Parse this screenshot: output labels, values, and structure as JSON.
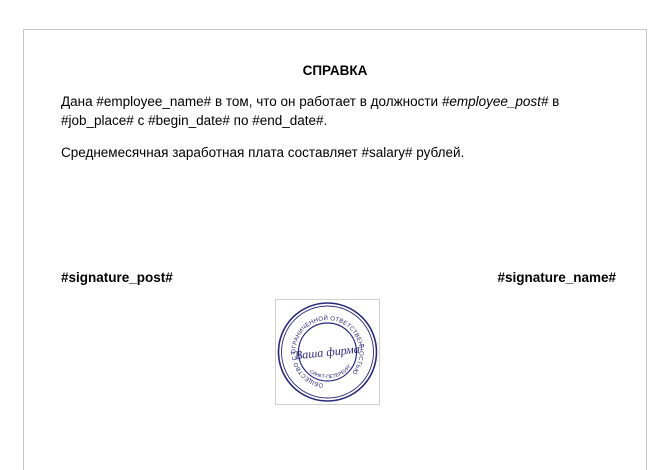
{
  "document": {
    "title": "СПРАВКА",
    "para1": {
      "t1": "Дана #employee_name# в том, что он работает в должности ",
      "post": "#employee_post#",
      "t2": " в #job_place# с #begin_date# по #end_date#."
    },
    "para2": "Среднемесячная заработная плата составляет #salary# рублей.",
    "signature_post": "#signature_post#",
    "signature_name": "#signature_name#"
  },
  "stamp": {
    "center_text": "\"Ваша фирма\"",
    "ring_text": "ОБЩЕСТВО С ОГРАНИЧЕННОЙ ОТВЕТСТВЕННОСТЬЮ",
    "city_text": "САНКТ-ПЕТЕРБУРГ",
    "color": "#2a2a7a"
  }
}
